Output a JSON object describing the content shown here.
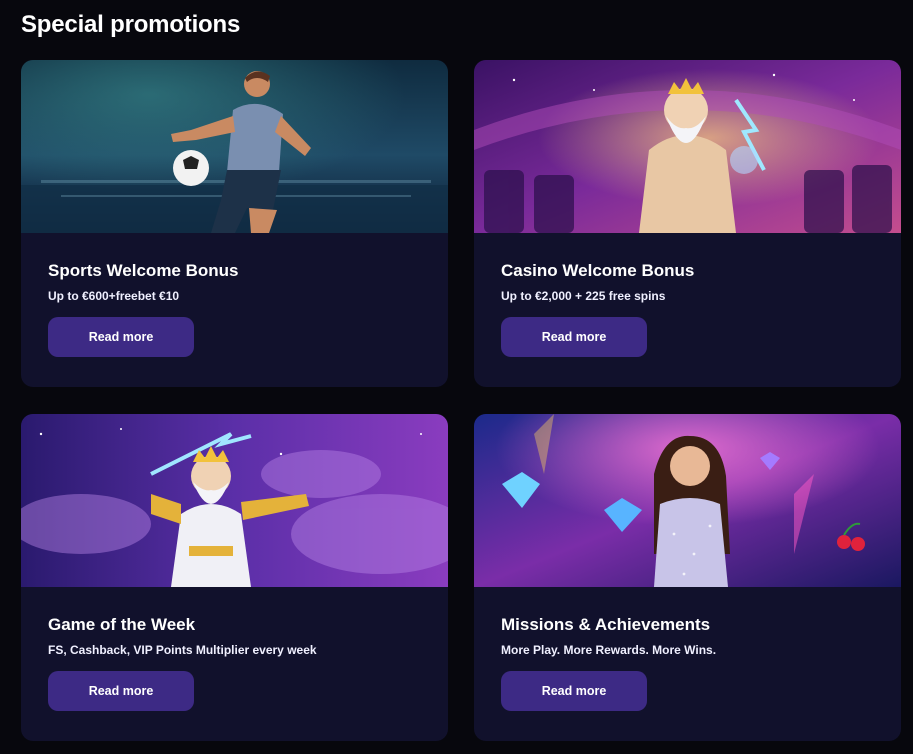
{
  "section": {
    "title": "Special promotions"
  },
  "promotions": [
    {
      "title": "Sports Welcome Bonus",
      "subtitle": "Up to €600+freebet €10",
      "button": "Read more",
      "image": "football-player-illustration"
    },
    {
      "title": "Casino Welcome Bonus",
      "subtitle": "Up to €2,000 + 225 free spins",
      "button": "Read more",
      "image": "zeus-casino-illustration"
    },
    {
      "title": "Game of the Week",
      "subtitle": "FS, Cashback, VIP Points Multiplier every week",
      "button": "Read more",
      "image": "zeus-lightning-illustration"
    },
    {
      "title": "Missions & Achievements",
      "subtitle": "More Play. More Rewards. More Wins.",
      "button": "Read more",
      "image": "woman-diamond-illustration"
    }
  ],
  "colors": {
    "page_bg": "#07070d",
    "card_bg": "#11112c",
    "button_bg": "#3d2a85",
    "text": "#ffffff"
  }
}
